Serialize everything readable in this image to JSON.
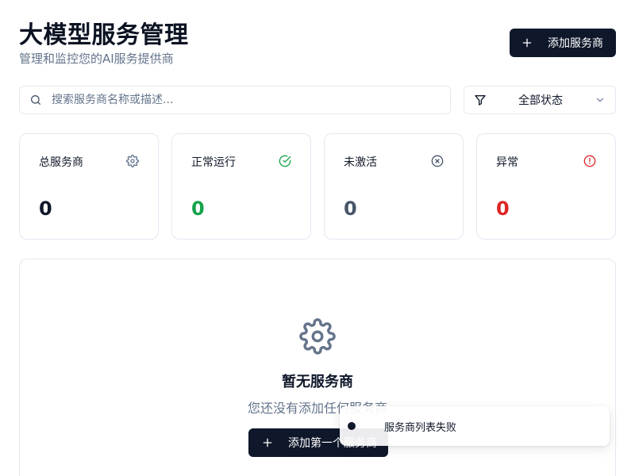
{
  "header": {
    "title": "大模型服务管理",
    "subtitle": "管理和监控您的AI服务提供商",
    "add_button_label": "添加服务商"
  },
  "toolbar": {
    "search_placeholder": "搜索服务商名称或描述...",
    "search_value": "",
    "status_filter_value": "全部状态"
  },
  "stats": [
    {
      "label": "总服务商",
      "value": "0",
      "icon": "gear-icon",
      "color": "#0f172a"
    },
    {
      "label": "正常运行",
      "value": "0",
      "icon": "check-circle-icon",
      "color": "#16a34a"
    },
    {
      "label": "未激活",
      "value": "0",
      "icon": "x-circle-icon",
      "color": "#475569"
    },
    {
      "label": "异常",
      "value": "0",
      "icon": "alert-circle-icon",
      "color": "#dc2626"
    }
  ],
  "empty_state": {
    "icon": "gear-icon",
    "title": "暂无服务商",
    "description": "您还没有添加任何服务商",
    "button_label": "添加第一个服务商"
  },
  "toast": {
    "message": "服务商列表失败"
  },
  "colors": {
    "primary": "#0f172a",
    "muted": "#64748b",
    "border": "#e2e8f0",
    "success": "#16a34a",
    "danger": "#dc2626"
  }
}
